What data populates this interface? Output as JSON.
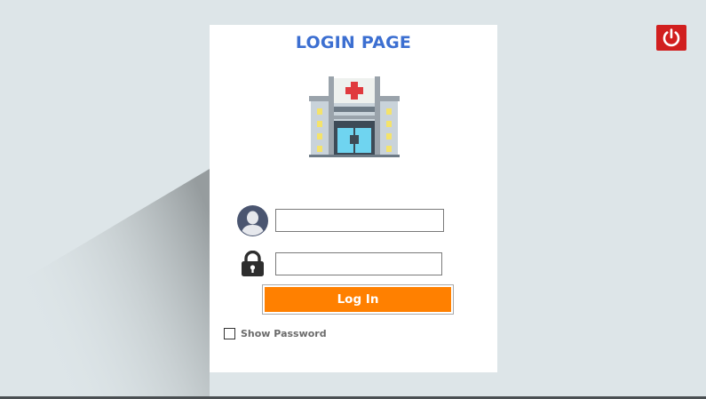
{
  "page": {
    "title": "LOGIN PAGE"
  },
  "icons": {
    "hospital": "hospital-building-icon",
    "user": "user-avatar-icon",
    "lock": "padlock-icon",
    "power": "power-icon"
  },
  "form": {
    "username": {
      "value": "",
      "placeholder": ""
    },
    "password": {
      "value": "",
      "placeholder": ""
    },
    "login_label": "Log In",
    "show_password_label": "Show Password",
    "show_password_checked": false
  },
  "colors": {
    "title": "#3c6fd1",
    "login_button": "#ff8000",
    "power_button": "#d11f1f",
    "background": "#dde5e8"
  }
}
